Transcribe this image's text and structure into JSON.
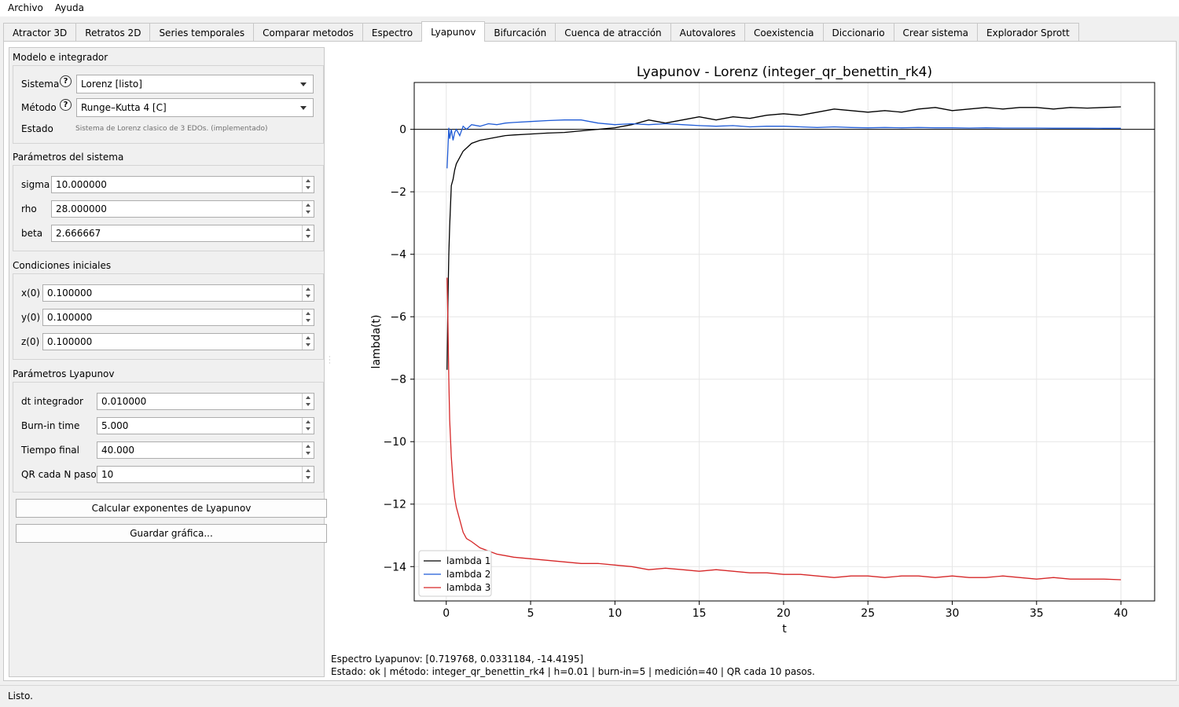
{
  "menubar": {
    "items": [
      "Archivo",
      "Ayuda"
    ]
  },
  "tabs": [
    "Atractor 3D",
    "Retratos 2D",
    "Series temporales",
    "Comparar metodos",
    "Espectro",
    "Lyapunov",
    "Bifurcación",
    "Cuenca de atracción",
    "Autovalores",
    "Coexistencia",
    "Diccionario",
    "Crear sistema",
    "Explorador Sprott"
  ],
  "active_tab": "Lyapunov",
  "model": {
    "title": "Modelo e integrador",
    "system_label": "Sistema",
    "system_value": "Lorenz [listo]",
    "method_label": "Método",
    "method_value": "Runge–Kutta 4 [C]",
    "state_label": "Estado",
    "state_value": "Sistema de Lorenz clasico de 3 EDOs. (implementado)",
    "help_glyph": "?"
  },
  "params": {
    "title": "Parámetros del sistema",
    "fields": [
      {
        "label": "sigma",
        "value": "10.000000"
      },
      {
        "label": "rho",
        "value": "28.000000"
      },
      {
        "label": "beta",
        "value": "2.666667"
      }
    ]
  },
  "initial": {
    "title": "Condiciones iniciales",
    "fields": [
      {
        "label": "x(0)",
        "value": "0.100000"
      },
      {
        "label": "y(0)",
        "value": "0.100000"
      },
      {
        "label": "z(0)",
        "value": "0.100000"
      }
    ]
  },
  "lyap": {
    "title": "Parámetros Lyapunov",
    "fields": [
      {
        "label": "dt integrador",
        "value": "0.010000"
      },
      {
        "label": "Burn-in time",
        "value": "5.000"
      },
      {
        "label": "Tiempo final",
        "value": "40.000"
      },
      {
        "label": "QR cada N pasos",
        "value": "10"
      }
    ]
  },
  "buttons": {
    "compute": "Calcular exponentes de Lyapunov",
    "save": "Guardar gráfica..."
  },
  "output": {
    "spectrum": "Espectro Lyapunov: [0.719768, 0.0331184, -14.4195]",
    "state": "Estado: ok | método: integer_qr_benettin_rk4 | h=0.01 | burn-in=5 | medición=40 | QR cada 10 pasos."
  },
  "statusbar": "Listo.",
  "chart_data": {
    "type": "line",
    "title": "Lyapunov - Lorenz (integer_qr_benettin_rk4)",
    "xlabel": "t",
    "ylabel": "lambda(t)",
    "xlim": [
      -1.9,
      42.0
    ],
    "ylim": [
      -15.1,
      1.5
    ],
    "xticks": [
      0,
      5,
      10,
      15,
      20,
      25,
      30,
      35,
      40
    ],
    "yticks": [
      0,
      -2,
      -4,
      -6,
      -8,
      -10,
      -12,
      -14
    ],
    "grid": true,
    "zero_line": true,
    "legend_position": "lower-left",
    "series": [
      {
        "name": "lambda 1",
        "color": "#000000",
        "x": [
          0.05,
          0.1,
          0.15,
          0.2,
          0.3,
          0.4,
          0.5,
          0.6,
          0.8,
          1.0,
          1.2,
          1.5,
          2,
          2.5,
          3,
          3.5,
          4,
          5,
          6,
          7,
          8,
          9,
          10,
          11,
          12,
          13,
          14,
          15,
          16,
          17,
          18,
          19,
          20,
          21,
          22,
          23,
          24,
          25,
          26,
          27,
          28,
          29,
          30,
          31,
          32,
          33,
          34,
          35,
          36,
          37,
          38,
          39,
          40
        ],
        "y": [
          -7.7,
          -5.5,
          -4.0,
          -3.1,
          -1.8,
          -1.6,
          -1.3,
          -1.1,
          -0.9,
          -0.7,
          -0.6,
          -0.45,
          -0.35,
          -0.3,
          -0.25,
          -0.2,
          -0.18,
          -0.15,
          -0.12,
          -0.1,
          -0.05,
          0.0,
          0.05,
          0.15,
          0.3,
          0.2,
          0.3,
          0.4,
          0.3,
          0.4,
          0.35,
          0.45,
          0.5,
          0.45,
          0.55,
          0.65,
          0.6,
          0.55,
          0.6,
          0.55,
          0.65,
          0.7,
          0.6,
          0.65,
          0.7,
          0.65,
          0.7,
          0.7,
          0.65,
          0.7,
          0.68,
          0.7,
          0.72
        ]
      },
      {
        "name": "lambda 2",
        "color": "#1f5bd6",
        "x": [
          0.05,
          0.1,
          0.15,
          0.2,
          0.3,
          0.4,
          0.5,
          0.6,
          0.8,
          1.0,
          1.2,
          1.5,
          2,
          2.5,
          3,
          3.5,
          4,
          5,
          6,
          7,
          8,
          9,
          10,
          11,
          12,
          13,
          14,
          15,
          16,
          17,
          18,
          19,
          20,
          21,
          22,
          23,
          24,
          25,
          26,
          27,
          28,
          29,
          30,
          31,
          32,
          33,
          34,
          35,
          36,
          37,
          38,
          39,
          40
        ],
        "y": [
          -1.25,
          -0.6,
          0.05,
          -0.3,
          0.0,
          -0.35,
          -0.1,
          0.0,
          -0.2,
          0.1,
          0.0,
          0.15,
          0.1,
          0.18,
          0.15,
          0.2,
          0.22,
          0.25,
          0.28,
          0.3,
          0.3,
          0.2,
          0.15,
          0.18,
          0.15,
          0.18,
          0.15,
          0.12,
          0.1,
          0.12,
          0.08,
          0.1,
          0.1,
          0.08,
          0.06,
          0.08,
          0.06,
          0.05,
          0.06,
          0.05,
          0.06,
          0.05,
          0.05,
          0.04,
          0.05,
          0.04,
          0.04,
          0.04,
          0.035,
          0.035,
          0.035,
          0.034,
          0.033
        ]
      },
      {
        "name": "lambda 3",
        "color": "#d62728",
        "x": [
          0.05,
          0.1,
          0.15,
          0.2,
          0.3,
          0.4,
          0.5,
          0.6,
          0.8,
          1.0,
          1.2,
          1.5,
          2,
          2.5,
          3,
          3.5,
          4,
          5,
          6,
          7,
          8,
          9,
          10,
          11,
          12,
          13,
          14,
          15,
          16,
          17,
          18,
          19,
          20,
          21,
          22,
          23,
          24,
          25,
          26,
          27,
          28,
          29,
          30,
          31,
          32,
          33,
          34,
          35,
          36,
          37,
          38,
          39,
          40
        ],
        "y": [
          -4.75,
          -6.2,
          -8.0,
          -9.3,
          -10.5,
          -11.3,
          -11.8,
          -12.1,
          -12.5,
          -12.9,
          -13.1,
          -13.2,
          -13.4,
          -13.5,
          -13.6,
          -13.65,
          -13.7,
          -13.75,
          -13.8,
          -13.85,
          -13.9,
          -13.9,
          -13.95,
          -14.0,
          -14.1,
          -14.05,
          -14.1,
          -14.15,
          -14.1,
          -14.15,
          -14.2,
          -14.2,
          -14.25,
          -14.25,
          -14.3,
          -14.35,
          -14.3,
          -14.3,
          -14.35,
          -14.3,
          -14.3,
          -14.35,
          -14.3,
          -14.35,
          -14.35,
          -14.3,
          -14.35,
          -14.4,
          -14.35,
          -14.4,
          -14.4,
          -14.4,
          -14.42
        ]
      }
    ]
  }
}
